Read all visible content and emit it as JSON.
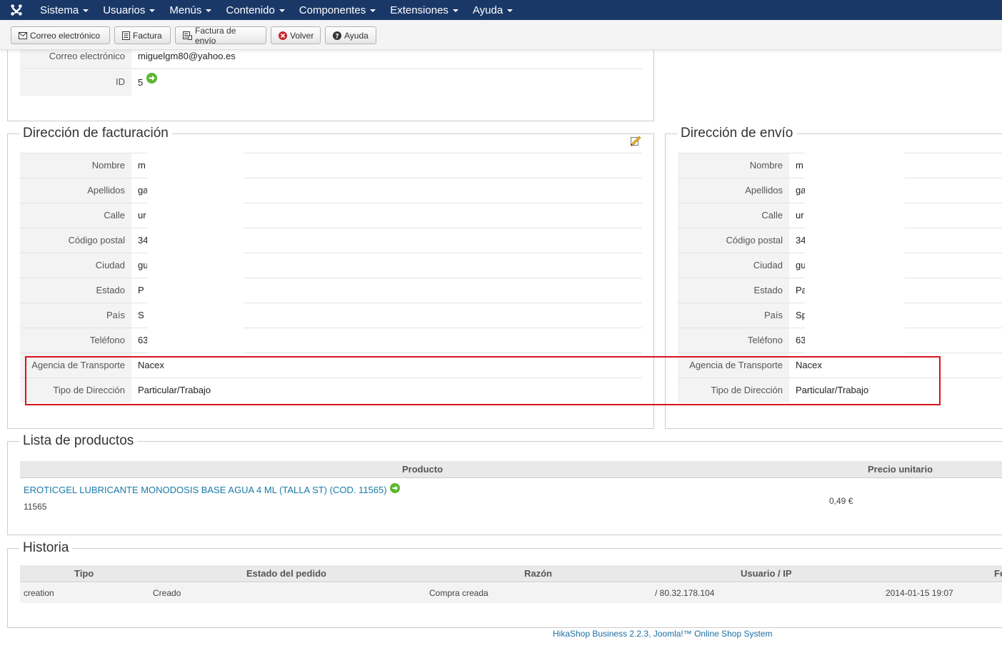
{
  "navbar": {
    "items": [
      {
        "label": "Sistema"
      },
      {
        "label": "Usuarios"
      },
      {
        "label": "Menús"
      },
      {
        "label": "Contenido"
      },
      {
        "label": "Componentes"
      },
      {
        "label": "Extensiones"
      },
      {
        "label": "Ayuda"
      }
    ],
    "bg_color": "#1a3867"
  },
  "toolbar": {
    "email_label": "Correo electrónico",
    "invoice_label": "Factura",
    "shipping_invoice_label": "Factura de envío",
    "back_label": "Volver",
    "help_label": "Ayuda"
  },
  "customer": {
    "email_label": "Correo electrónico",
    "email_value": "miguelgm80@yahoo.es",
    "id_label": "ID",
    "id_value": "5"
  },
  "billing": {
    "title": "Dirección de facturación",
    "rows": [
      {
        "label": "Nombre",
        "value": "m"
      },
      {
        "label": "Apellidos",
        "value": "ga"
      },
      {
        "label": "Calle",
        "value": "ur"
      },
      {
        "label": "Código postal",
        "value": "34"
      },
      {
        "label": "Ciudad",
        "value": "gu"
      },
      {
        "label": "Estado",
        "value": "P"
      },
      {
        "label": "País",
        "value": "S"
      },
      {
        "label": "Teléfono",
        "value": "63"
      },
      {
        "label": "Agencia de Transporte",
        "value": "Nacex"
      },
      {
        "label": "Tipo de Dirección",
        "value": "Particular/Trabajo"
      }
    ]
  },
  "shipping": {
    "title": "Dirección de envío",
    "rows": [
      {
        "label": "Nombre",
        "value": "m"
      },
      {
        "label": "Apellidos",
        "value": "ga"
      },
      {
        "label": "Calle",
        "value": "ur"
      },
      {
        "label": "Código postal",
        "value": "34"
      },
      {
        "label": "Ciudad",
        "value": "gu"
      },
      {
        "label": "Estado",
        "value": "Pa"
      },
      {
        "label": "País",
        "value": "Sp"
      },
      {
        "label": "Teléfono",
        "value": "63"
      },
      {
        "label": "Agencia de Transporte",
        "value": "Nacex"
      },
      {
        "label": "Tipo de Dirección",
        "value": "Particular/Trabajo"
      }
    ]
  },
  "products": {
    "title": "Lista de productos",
    "headers": {
      "product": "Producto",
      "unit_price": "Precio unitario"
    },
    "items": [
      {
        "name": "EROTICGEL LUBRICANTE MONODOSIS BASE AGUA 4 ML (TALLA ST) (COD. 11565)",
        "code": "11565",
        "unit_price": "0,49 €"
      }
    ]
  },
  "history": {
    "title": "Historia",
    "headers": {
      "type": "Tipo",
      "status": "Estado del pedido",
      "reason": "Razón",
      "user_ip": "Usuario / IP",
      "date": "Fe"
    },
    "rows": [
      {
        "type": "creation",
        "status": "Creado",
        "reason": "Compra creada",
        "user_ip": "/ 80.32.178.104",
        "date": "2014-01-15 19:07"
      }
    ]
  },
  "footer": {
    "text": "HikaShop Business 2.2.3, Joomla!™ Online Shop System"
  },
  "colors": {
    "highlight": "#d8141b",
    "link": "#1a7aa8",
    "go_icon": "#5cb531"
  }
}
